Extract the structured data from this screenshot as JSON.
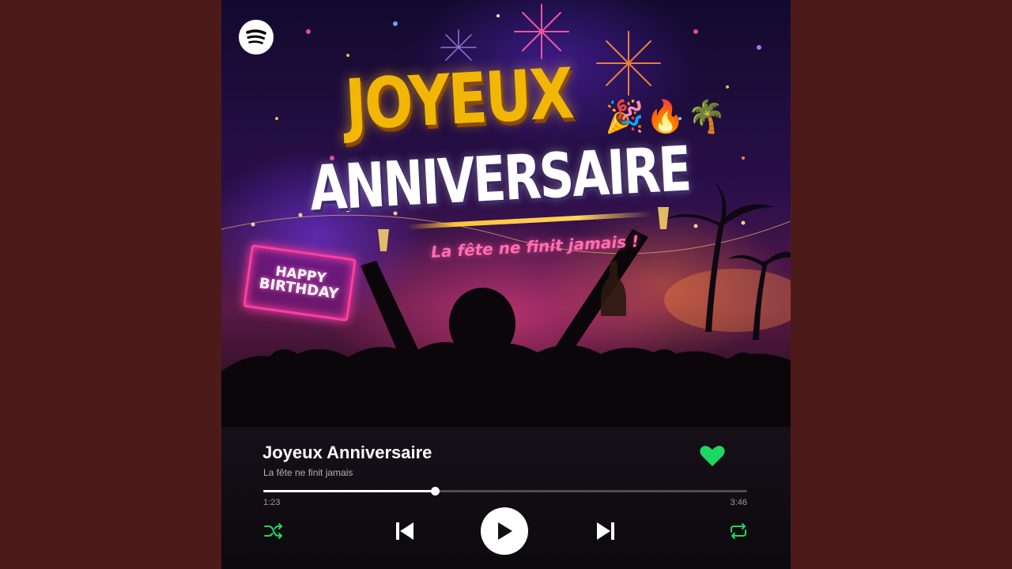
{
  "artwork": {
    "title_line1": "JOYEUX",
    "title_line2": "ANNIVERSAIRE",
    "tagline": "La fête ne finit jamais !",
    "emojis": "🎉🔥🌴",
    "neon_sign_line1": "HAPPY",
    "neon_sign_line2": "BIRTHDAY"
  },
  "player": {
    "song_title": "Joyeux Anniversaire",
    "subtitle": "La fête ne finit jamais",
    "liked": true,
    "progress_fraction": 0.355,
    "time_elapsed": "1:23",
    "time_total": "3:46",
    "is_playing": false
  },
  "icons": {
    "brand": "spotify-icon",
    "like": "heart-icon",
    "shuffle": "shuffle-icon",
    "previous": "skip-previous-icon",
    "play": "play-icon",
    "next": "skip-next-icon",
    "repeat": "repeat-icon"
  },
  "colors": {
    "background": "#4d1a1a",
    "accent_green": "#1ed760",
    "title_gold": "#f2b705",
    "neon_pink": "#ff3fa0"
  }
}
